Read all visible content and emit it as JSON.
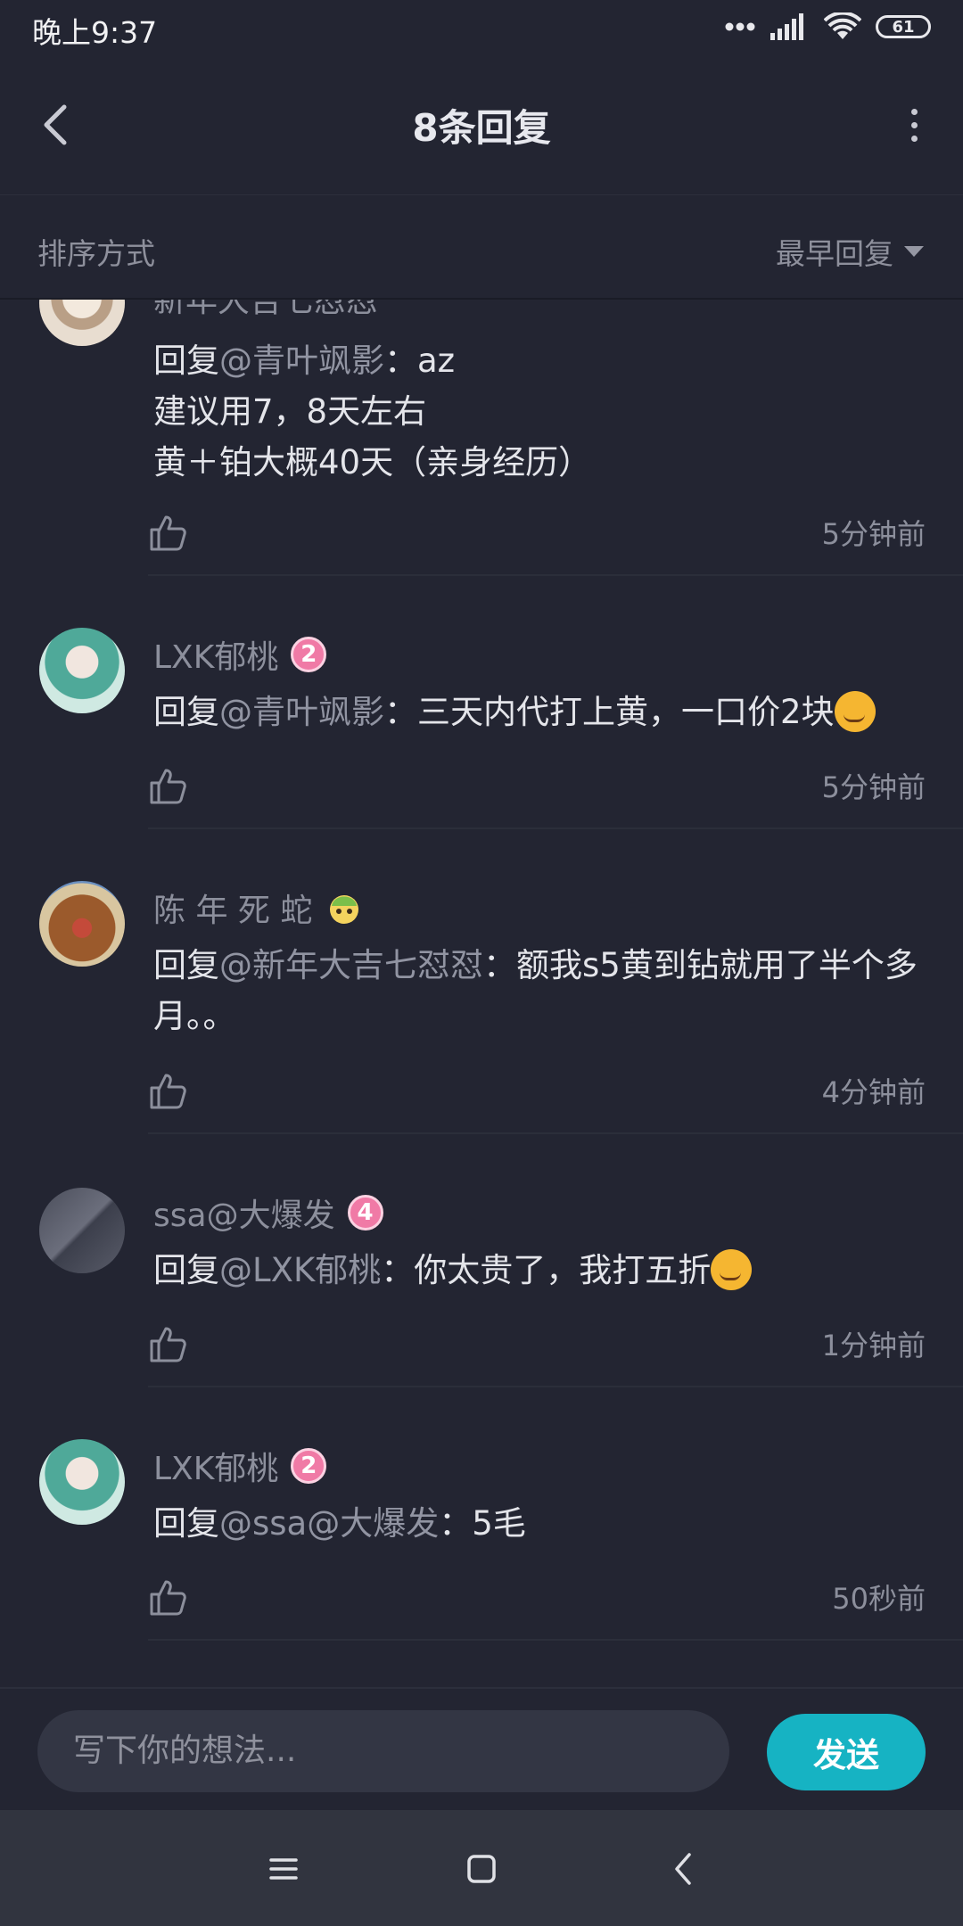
{
  "status": {
    "time": "晚上9:37",
    "battery": "61"
  },
  "header": {
    "title": "8条回复"
  },
  "sort": {
    "label": "排序方式",
    "selected": "最早回复"
  },
  "partial_top": {
    "name": "新年大吉七怼怼",
    "lines": [
      {
        "prefix": "回复",
        "mention": "@青叶飒影",
        "text": "：az"
      },
      {
        "text": "建议用7，8天左右"
      },
      {
        "text": "黄＋铂大概40天（亲身经历）"
      }
    ],
    "time": "5分钟前"
  },
  "replies": [
    {
      "name": "LXK郁桃",
      "level": "2",
      "prefix": "回复",
      "mention": "@青叶飒影",
      "text": "：三天内代打上黄，一口价2块",
      "emoji": "smirk",
      "time": "5分钟前"
    },
    {
      "name": "陈 年 死 蛇",
      "level": "",
      "prefix": "回复",
      "mention": "@新年大吉七怼怼",
      "text": "：额我s5黄到钻就用了半个多月。。",
      "emoji": "",
      "time": "4分钟前"
    },
    {
      "name": "ssa@大爆发",
      "level": "4",
      "prefix": "回复",
      "mention": "@LXK郁桃",
      "text": "：你太贵了，我打五折",
      "emoji": "smirk",
      "time": "1分钟前"
    },
    {
      "name": "LXK郁桃",
      "level": "2",
      "prefix": "回复",
      "mention": "@ssa@大爆发",
      "text": "：5毛",
      "emoji": "",
      "time": "50秒前"
    }
  ],
  "input": {
    "placeholder": "写下你的想法...",
    "send": "发送"
  },
  "icons": {
    "back": "back-arrow-icon",
    "more": "more-vertical-icon",
    "sort": "caret-down-icon",
    "like": "thumbs-up-icon",
    "nav_menu": "menu-icon",
    "nav_home": "home-square-icon",
    "nav_back": "nav-back-icon"
  },
  "colors": {
    "background": "#232532",
    "accent": "#16b3c3",
    "badge": "#f07aa6",
    "muted": "#8c8f9c"
  }
}
